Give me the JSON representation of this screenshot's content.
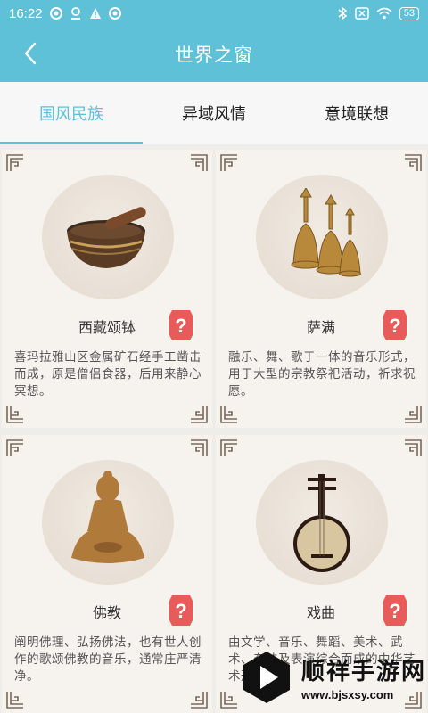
{
  "status_bar": {
    "time": "16:22",
    "battery": "53",
    "icons": [
      "circle-dot-icon",
      "person-icon",
      "warning-icon",
      "circle-dot-icon",
      "bluetooth-icon",
      "sim-x-icon",
      "wifi-icon",
      "battery-icon"
    ]
  },
  "header": {
    "title": "世界之窗",
    "back_icon": "chevron-left-icon"
  },
  "tabs": [
    {
      "label": "国风民族",
      "active": true
    },
    {
      "label": "异域风情",
      "active": false
    },
    {
      "label": "意境联想",
      "active": false
    }
  ],
  "cards": [
    {
      "title": "西藏颂钵",
      "desc": "喜玛拉雅山区金属矿石经手工凿击而成，原是僧侣食器，后用来静心冥想。",
      "image": "singing-bowl-image"
    },
    {
      "title": "萨满",
      "desc": "融乐、舞、歌于一体的音乐形式，用于大型的宗教祭祀活动，祈求祝愿。",
      "image": "shaman-bells-image"
    },
    {
      "title": "佛教",
      "desc": "阐明佛理、弘扬佛法，也有世人创作的歌颂佛教的音乐，通常庄严清净。",
      "image": "buddha-statue-image"
    },
    {
      "title": "戏曲",
      "desc": "由文学、音乐、舞蹈、美术、武术、杂技及表演综合而成的中华艺术形式。",
      "image": "yueqin-image"
    }
  ],
  "help_icon": "question-badge-icon",
  "watermark": {
    "name": "顺祥手游网",
    "url": "www.bjsxsy.com"
  },
  "colors": {
    "accent": "#5ec1d8",
    "badge": "#e95a5a",
    "card_bg": "#f6f2ee"
  }
}
